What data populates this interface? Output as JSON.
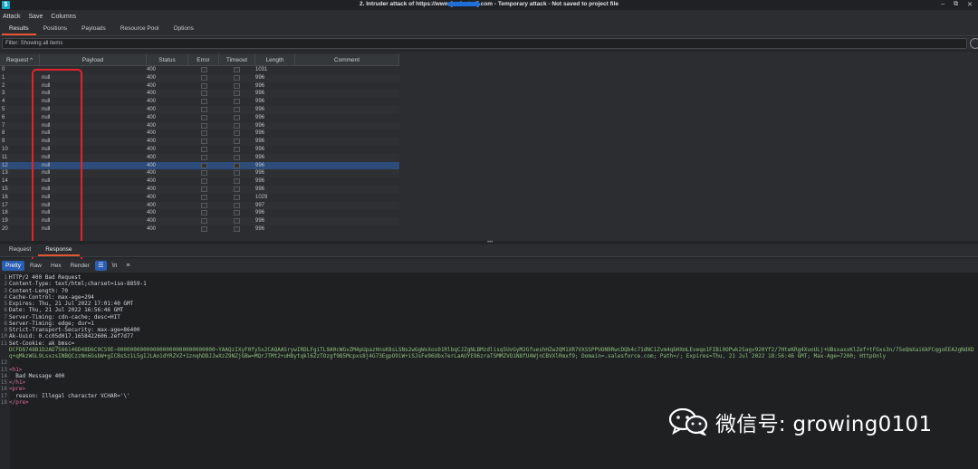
{
  "window": {
    "title": "2. Intruder attack of https://www.[redacted].com - Temporary attack - Not saved to project file",
    "controls": [
      "–",
      "⧉",
      "✕"
    ]
  },
  "menubar": [
    "Attack",
    "Save",
    "Columns"
  ],
  "tabs": [
    "Results",
    "Positions",
    "Payloads",
    "Resource Pool",
    "Options"
  ],
  "filter": {
    "text": "Filter: Showing all items"
  },
  "table": {
    "headers": {
      "request": "Request ^",
      "payload": "Payload",
      "status": "Status",
      "error": "Error",
      "timeout": "Timeout",
      "length": "Length",
      "comment": "Comment"
    },
    "rows": [
      {
        "request": "0",
        "payload": "",
        "status": "400",
        "length": "1031"
      },
      {
        "request": "1",
        "payload": "null",
        "status": "400",
        "length": "996"
      },
      {
        "request": "2",
        "payload": "null",
        "status": "400",
        "length": "996"
      },
      {
        "request": "3",
        "payload": "null",
        "status": "400",
        "length": "996"
      },
      {
        "request": "4",
        "payload": "null",
        "status": "400",
        "length": "996"
      },
      {
        "request": "5",
        "payload": "null",
        "status": "400",
        "length": "996"
      },
      {
        "request": "6",
        "payload": "null",
        "status": "400",
        "length": "996"
      },
      {
        "request": "7",
        "payload": "null",
        "status": "400",
        "length": "996"
      },
      {
        "request": "8",
        "payload": "null",
        "status": "400",
        "length": "996"
      },
      {
        "request": "9",
        "payload": "null",
        "status": "400",
        "length": "996"
      },
      {
        "request": "10",
        "payload": "null",
        "status": "400",
        "length": "996"
      },
      {
        "request": "11",
        "payload": "null",
        "status": "400",
        "length": "996"
      },
      {
        "request": "12",
        "payload": "null",
        "status": "400",
        "length": "996"
      },
      {
        "request": "13",
        "payload": "null",
        "status": "400",
        "length": "996"
      },
      {
        "request": "14",
        "payload": "null",
        "status": "400",
        "length": "996"
      },
      {
        "request": "15",
        "payload": "null",
        "status": "400",
        "length": "996"
      },
      {
        "request": "16",
        "payload": "null",
        "status": "400",
        "length": "1029"
      },
      {
        "request": "17",
        "payload": "null",
        "status": "400",
        "length": "997"
      },
      {
        "request": "18",
        "payload": "null",
        "status": "400",
        "length": "996"
      },
      {
        "request": "19",
        "payload": "null",
        "status": "400",
        "length": "996"
      },
      {
        "request": "20",
        "payload": "null",
        "status": "400",
        "length": "996"
      }
    ],
    "selected_request": "12"
  },
  "subtabs": [
    "Request",
    "Response"
  ],
  "viewtabs": [
    "Pretty",
    "Raw",
    "Hex",
    "Render"
  ],
  "view_icons": [
    "☰",
    "\\n",
    "≡"
  ],
  "response": {
    "lines": [
      {
        "n": "1",
        "text": "HTTP/2 400 Bad Request"
      },
      {
        "n": "2",
        "text": "Content-Type: text/html;charset=iso-8859-1"
      },
      {
        "n": "3",
        "text": "Content-Length: 70"
      },
      {
        "n": "4",
        "text": "Cache-Control: max-age=294"
      },
      {
        "n": "5",
        "text": "Expires: Thu, 21 Jul 2022 17:01:40 GMT"
      },
      {
        "n": "6",
        "text": "Date: Thu, 21 Jul 2022 16:56:46 GMT"
      },
      {
        "n": "7",
        "text": "Server-Timing: cdn-cache; desc=HIT"
      },
      {
        "n": "8",
        "text": "Server-Timing: edge; dur=1"
      },
      {
        "n": "9",
        "text": "Strict-Transport-Security: max-age=86400"
      },
      {
        "n": "10",
        "text": "Ak-Uuid: 0.cc05d017.1658422606.2ef7d77"
      },
      {
        "n": "11",
        "text": "Set-Cookie: ak_bmsc="
      },
      {
        "n": "",
        "text": "DCFD8748B1D2AD7566146D48D6C0C59E~000000000000000000000000000000~YAAQzIXyF0fy5x2CAQAASrywIRDLFgiTL9A0cWGvZM4pUpazHnsK8sLSNs2wGgWxXos01RlbqCJZgNLBMzdlisq5UvGyM2GfueshHZw2QM1XR7VXSSPPUON9RwcDQb4c71dNC1Zvm4qbHXmLEveqo1FIBi0OPwk25agv920Yf2/7HteKRg4XuoULj+UBsxaxxKlZef+tFGxs3n/75eQmXai6kFCqgoEEA2gNdXDq+qMkzWGL9LsxzsINBQCzzNn6GsbW+gICBsSz1L5gIJLAo1dYRZVZ+1znqhDDJJwXzZ9NZjGBw=MQrJTMt2+uH8ytqkl6ZzTOzgf9B5Mcpxs8j4G73EgpO9iW+iSJsFe96Ubx7erLaAUYE96zraTSMMZVO1N8fU4WjnCBVXlRmxf9; Domain=.salesforce.com; Path=/; Expires=Thu, 21 Jul 2022 18:56:46 GMT; Max-Age=7200; HttpOnly",
        "wrap": true
      },
      {
        "n": "12",
        "text": ""
      },
      {
        "n": "13",
        "text": "<h1>"
      },
      {
        "n": "14",
        "text": "  Bad Message 400"
      },
      {
        "n": "15",
        "text": "</h1>"
      },
      {
        "n": "16",
        "text": "<pre>"
      },
      {
        "n": "17",
        "text": "  reason: Illegal character VCHAR='\\'"
      },
      {
        "n": "18",
        "text": "</pre>"
      }
    ]
  },
  "watermark": {
    "text": "微信号: growing0101"
  },
  "colors": {
    "accent_tab": "#e5542f",
    "selected_row": "#2d4c7a",
    "highlight_box": "#e3242b",
    "active_button": "#2a5fb3"
  }
}
